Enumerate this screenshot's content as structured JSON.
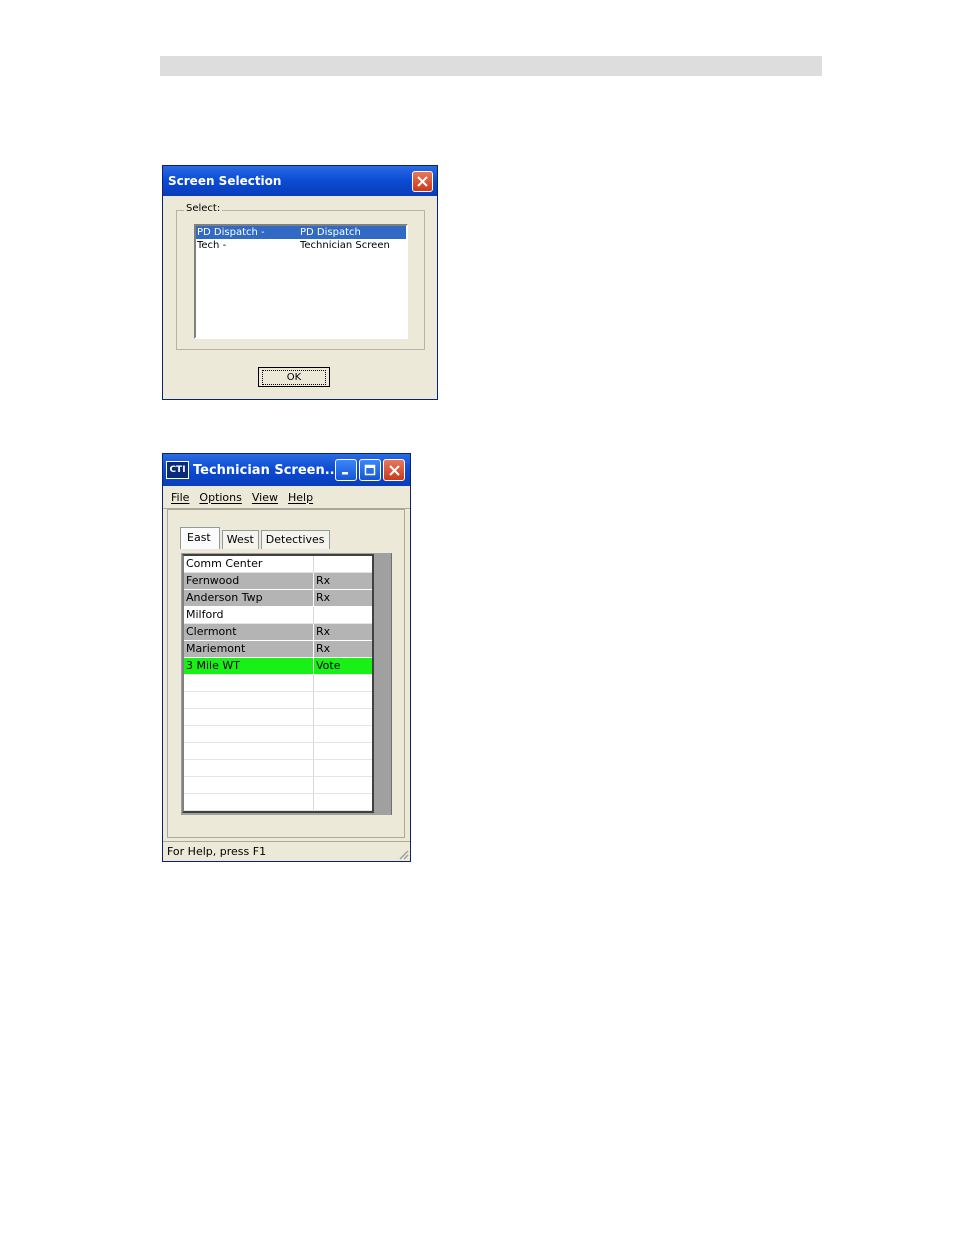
{
  "screen_selection": {
    "title": "Screen Selection",
    "group_label": "Select:",
    "items": [
      {
        "name": "PD Dispatch -",
        "description": "PD Dispatch",
        "selected": true
      },
      {
        "name": "Tech -",
        "description": "Technician Screen",
        "selected": false
      }
    ],
    "ok_label": "OK"
  },
  "technician_window": {
    "app_icon": "CTI",
    "title": "Technician Screen...",
    "menu": [
      "File",
      "Options",
      "View",
      "Help"
    ],
    "tabs": [
      "East",
      "West",
      "Detectives"
    ],
    "active_tab": "East",
    "rows": [
      {
        "site": "Comm Center",
        "status": "",
        "style": "white"
      },
      {
        "site": "Fernwood",
        "status": "Rx",
        "style": "grey"
      },
      {
        "site": "Anderson Twp",
        "status": "Rx",
        "style": "grey"
      },
      {
        "site": "Milford",
        "status": "",
        "style": "white"
      },
      {
        "site": "Clermont",
        "status": "Rx",
        "style": "grey"
      },
      {
        "site": "Mariemont",
        "status": "Rx",
        "style": "grey"
      },
      {
        "site": "3 Mile WT",
        "status": "Vote",
        "style": "green"
      },
      {
        "site": "",
        "status": "",
        "style": "white"
      },
      {
        "site": "",
        "status": "",
        "style": "white"
      },
      {
        "site": "",
        "status": "",
        "style": "white"
      },
      {
        "site": "",
        "status": "",
        "style": "white"
      },
      {
        "site": "",
        "status": "",
        "style": "white"
      },
      {
        "site": "",
        "status": "",
        "style": "white"
      },
      {
        "site": "",
        "status": "",
        "style": "white"
      },
      {
        "site": "",
        "status": "",
        "style": "white"
      }
    ],
    "status_text": "For Help, press F1"
  },
  "colors": {
    "titlebar": "#0b4ad3",
    "selection": "#316ac5",
    "row_grey": "#b4b4b4",
    "row_green": "#18f018",
    "dialog_bg": "#ece9d8"
  }
}
